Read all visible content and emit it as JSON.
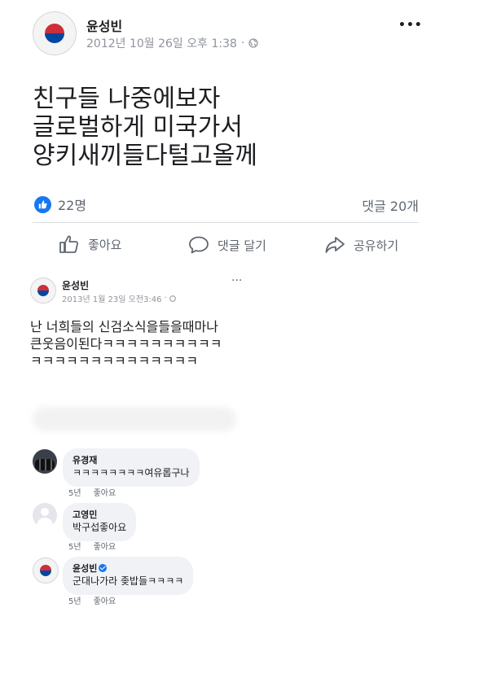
{
  "post1": {
    "author": "윤성빈",
    "timestamp": "2012년 10월 26일 오후 1:38",
    "privacy_icon": "globe-icon",
    "more_label": "•••",
    "text_lines": [
      "친구들 나중에보자",
      "글로벌하게 미국가서",
      "양키새끼들다털고올께"
    ],
    "reactions_count": "22명",
    "comments_count": "댓글 20개",
    "actions": {
      "like": "좋아요",
      "comment": "댓글 달기",
      "share": "공유하기"
    }
  },
  "post2": {
    "author": "윤성빈",
    "timestamp": "2013년 1월 23일 오전3:46",
    "more_label": "···",
    "text_lines": [
      "난 너희들의 신검소식을들을때마나",
      "큰웃음이된다ㅋㅋㅋㅋㅋㅋㅋㅋㅋㅋ",
      "ㅋㅋㅋㅋㅋㅋㅋㅋㅋㅋㅋㅋㅋㅋ"
    ]
  },
  "comments": [
    {
      "name": "유경재",
      "text": "ㅋㅋㅋㅋㅋㅋㅋㅋ여유롭구나",
      "time": "5년",
      "like": "좋아요"
    },
    {
      "name": "고영민",
      "text": "박구섭좋아요",
      "time": "5년",
      "like": "좋아요"
    },
    {
      "name": "윤성빈",
      "text": "군대나가라 좆밥들ㅋㅋㅋㅋ",
      "time": "5년",
      "like": "좋아요",
      "verified": true
    }
  ],
  "colors": {
    "like_blue": "#1877f2",
    "meta_gray": "#90949c",
    "bubble_bg": "#f0f2f5",
    "flag_red": "#cd2e3a",
    "flag_blue": "#0047a0"
  }
}
